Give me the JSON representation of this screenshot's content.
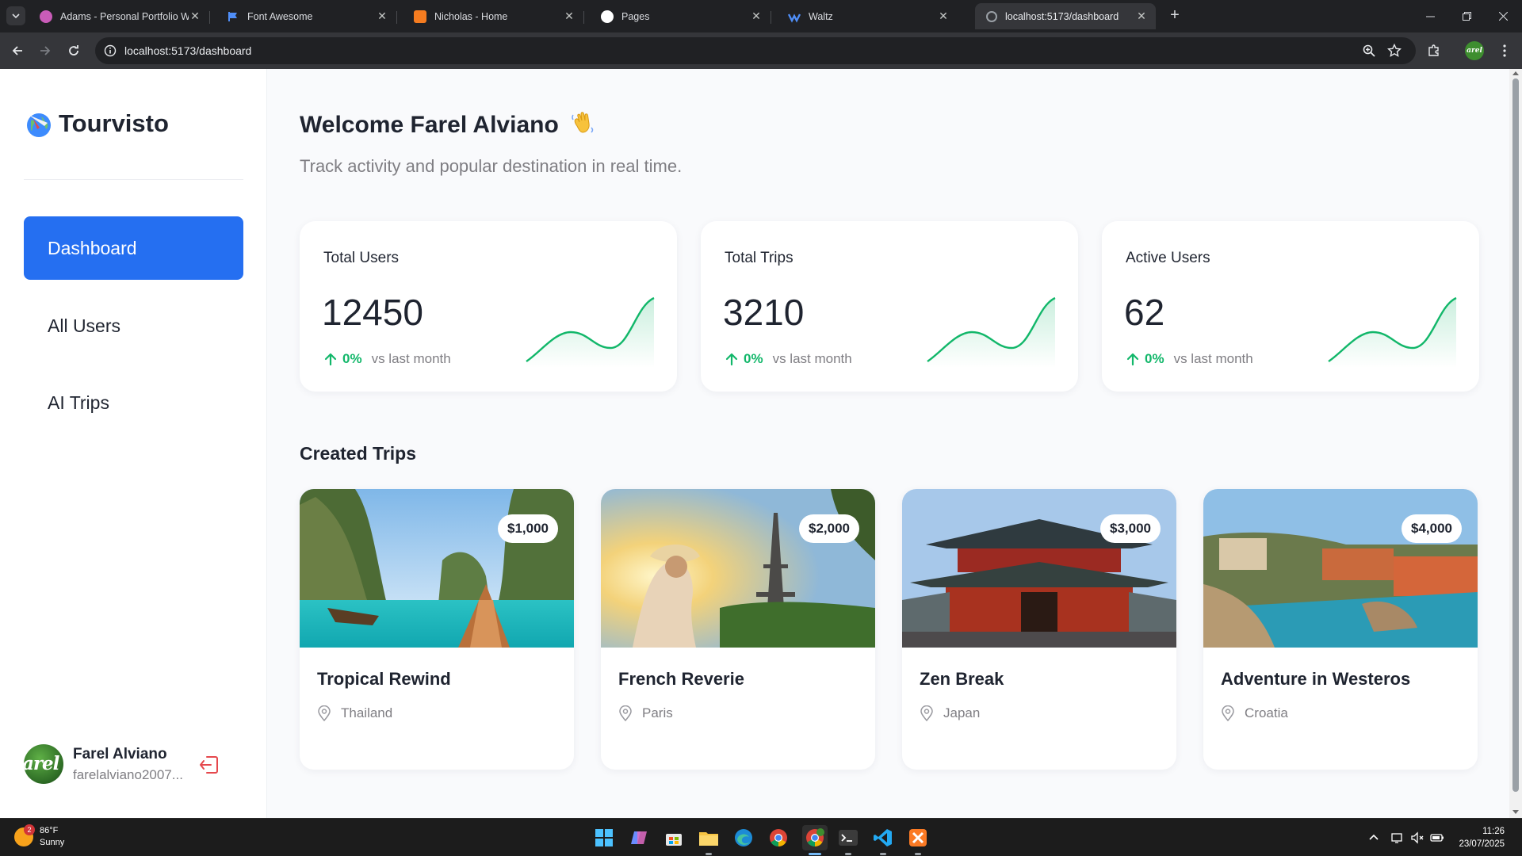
{
  "browser": {
    "tabs": [
      {
        "title": "Adams - Personal Portfolio Web",
        "active": false
      },
      {
        "title": "Font Awesome",
        "active": false
      },
      {
        "title": "Nicholas - Home",
        "active": false
      },
      {
        "title": "Pages",
        "active": false
      },
      {
        "title": "Waltz",
        "active": false
      },
      {
        "title": "localhost:5173/dashboard",
        "active": true
      }
    ],
    "new_tab_symbol": "+",
    "close_symbol": "✕",
    "url": "localhost:5173/dashboard",
    "profile_initials": "arel"
  },
  "sidebar": {
    "brand": "Tourvisto",
    "nav": [
      {
        "label": "Dashboard",
        "active": true
      },
      {
        "label": "All Users",
        "active": false
      },
      {
        "label": "AI Trips",
        "active": false
      }
    ],
    "user": {
      "name": "Farel Alviano",
      "email": "farelalviano2007...",
      "avatar_text": "arel"
    }
  },
  "main": {
    "welcome": "Welcome Farel Alviano",
    "subtitle": "Track activity and popular destination in real time.",
    "stats": [
      {
        "label": "Total Users",
        "value": "12450",
        "change": "0%",
        "compare": "vs last month"
      },
      {
        "label": "Total Trips",
        "value": "3210",
        "change": "0%",
        "compare": "vs last month"
      },
      {
        "label": "Active Users",
        "value": "62",
        "change": "0%",
        "compare": "vs last month"
      }
    ],
    "trips_heading": "Created Trips",
    "trips": [
      {
        "name": "Tropical Rewind",
        "location": "Thailand",
        "price": "$1,000"
      },
      {
        "name": "French Reverie",
        "location": "Paris",
        "price": "$2,000"
      },
      {
        "name": "Zen Break",
        "location": "Japan",
        "price": "$3,000"
      },
      {
        "name": "Adventure in Westeros",
        "location": "Croatia",
        "price": "$4,000"
      }
    ]
  },
  "colors": {
    "accent": "#256ff1",
    "positive": "#12b76a",
    "logout": "#e5484d"
  },
  "taskbar": {
    "weather_badge": "2",
    "temperature": "86°F",
    "condition": "Sunny",
    "time": "11:26",
    "date": "23/07/2025"
  }
}
